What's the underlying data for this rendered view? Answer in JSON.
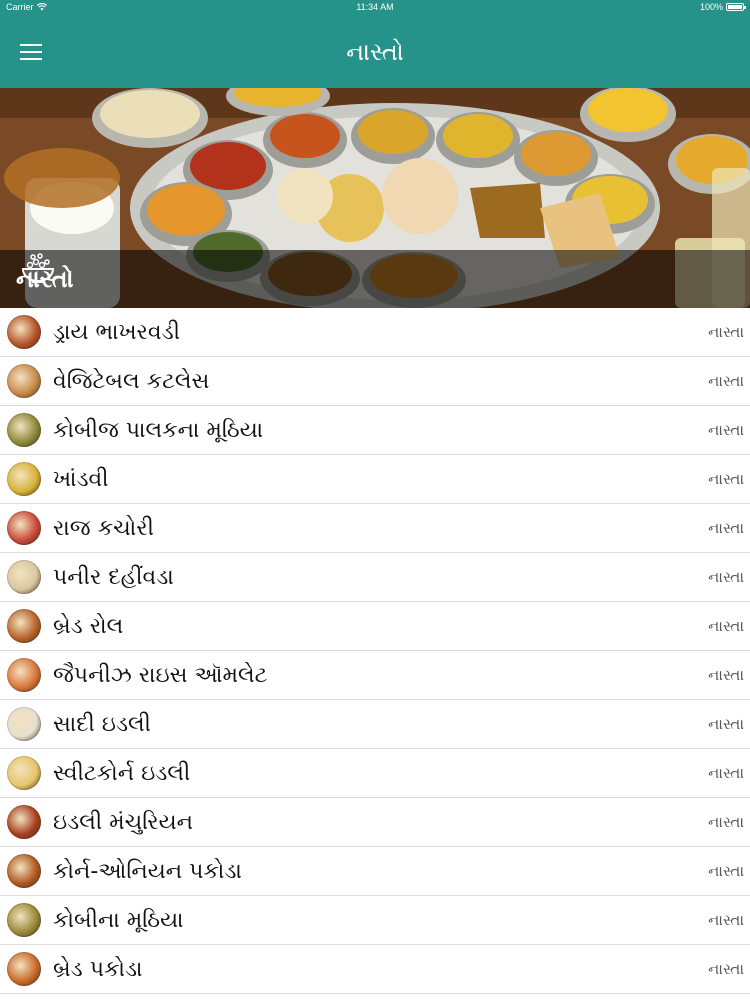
{
  "status_bar": {
    "carrier": "Carrier",
    "time": "11:34 AM",
    "battery": "100%",
    "battery_level": 1.0
  },
  "nav": {
    "title": "નાસ્તો",
    "menu_icon": "hamburger-menu-icon"
  },
  "banner": {
    "title": "નાસ્તો",
    "icon": "food-bowl-icon"
  },
  "list": {
    "items": [
      {
        "name": "ડ્રાય ભાખરવડી",
        "category": "નાસ્તા",
        "thumb_color": "#b5542a"
      },
      {
        "name": "વેજિટેબલ કટલેસ",
        "category": "નાસ્તા",
        "thumb_color": "#c98a4b"
      },
      {
        "name": "કોબીજ પાલકના મૂઠિયા",
        "category": "નાસ્તા",
        "thumb_color": "#8c8a3a"
      },
      {
        "name": "ખાંડવી",
        "category": "નાસ્તા",
        "thumb_color": "#d8b33a"
      },
      {
        "name": "રાજ કચોરી",
        "category": "નાસ્તા",
        "thumb_color": "#c94a3a"
      },
      {
        "name": "પનીર દહીંવડા",
        "category": "નાસ્તા",
        "thumb_color": "#d9c7a0"
      },
      {
        "name": "બ્રેડ રોલ",
        "category": "નાસ્તા",
        "thumb_color": "#b8642a"
      },
      {
        "name": "જૈપનીઝ રાઇસ ઑમલેટ",
        "category": "નાસ્તા",
        "thumb_color": "#d9763a"
      },
      {
        "name": "સાદી ઇડલી",
        "category": "નાસ્તા",
        "thumb_color": "#e6e0cf"
      },
      {
        "name": "સ્વીટકોર્ન ઇડલી",
        "category": "નાસ્તા",
        "thumb_color": "#e8c56a"
      },
      {
        "name": "ઇડલી મંચુરિયન",
        "category": "નાસ્તા",
        "thumb_color": "#a8401f"
      },
      {
        "name": "કોર્ન-ઓનિયન પકોડા",
        "category": "નાસ્તા",
        "thumb_color": "#b05a22"
      },
      {
        "name": "કોબીના મૂઠિયા",
        "category": "નાસ્તા",
        "thumb_color": "#9a8a3a"
      },
      {
        "name": "બ્રેડ પકોડા",
        "category": "નાસ્તા",
        "thumb_color": "#c96a2a"
      }
    ]
  },
  "colors": {
    "accent": "#26938a",
    "divider": "#dcdcdc"
  }
}
